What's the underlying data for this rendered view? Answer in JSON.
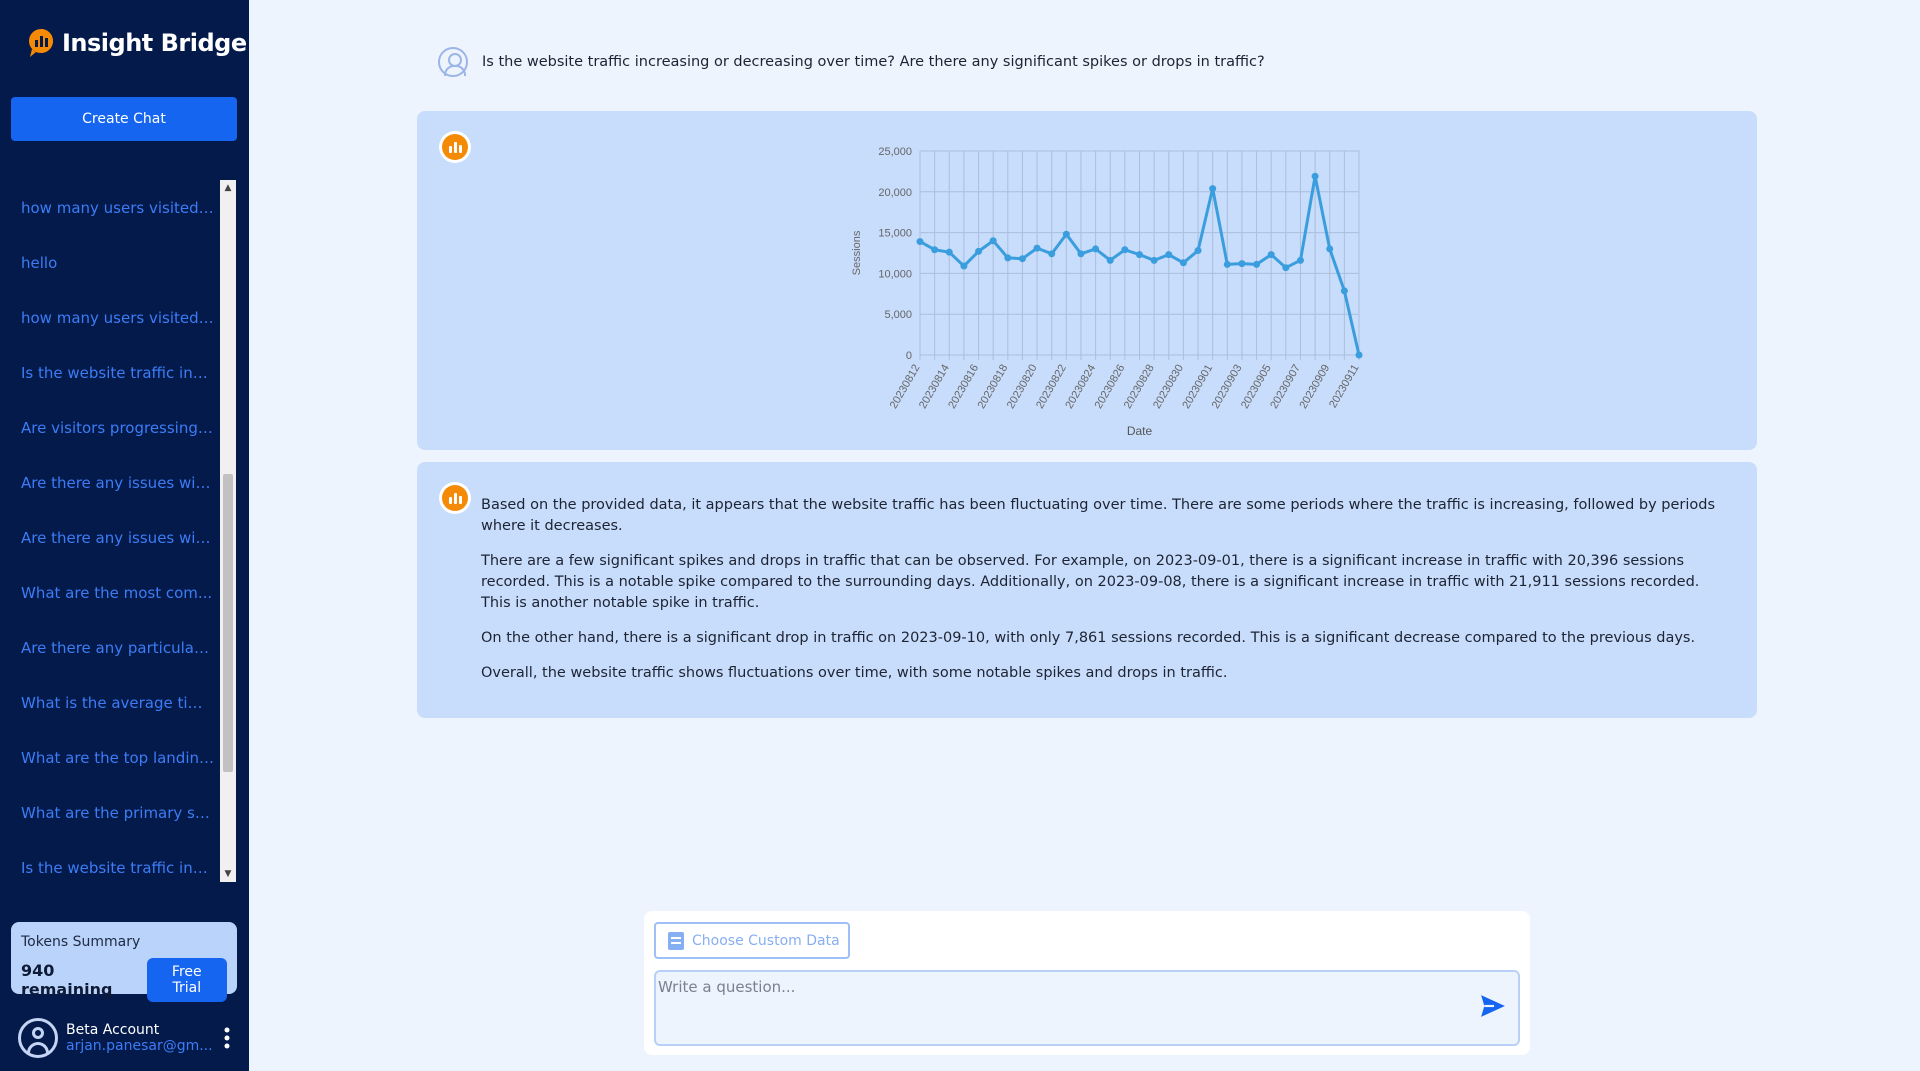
{
  "app": {
    "name": "Insight Bridge",
    "brand_color": "#1565f0",
    "accent_color": "#f58a07",
    "sidebar_color": "#031a4b"
  },
  "sidebar": {
    "create_chat_label": "Create Chat",
    "history": [
      "how many users visited t...",
      "hello",
      "how many users visited t...",
      "Is the website traffic incr...",
      "Are visitors progressing t...",
      "Are there any issues with ...",
      "Are there any issues with ...",
      "What are the most com...",
      "Are there any particular ...",
      "What is the average time...",
      "What are the top landing...",
      "What are the primary so...",
      "Is the website traffic incr..."
    ],
    "tokens": {
      "title": "Tokens Summary",
      "remaining": "940 remaining",
      "plan_label": "Free Trial"
    },
    "account": {
      "name": "Beta Account",
      "email": "arjan.panesar@gm..."
    }
  },
  "conversation": {
    "user_question": "Is the website traffic increasing or decreasing over time? Are there any significant spikes or drops in traffic?",
    "answer_paragraphs": [
      "Based on the provided data, it appears that the website traffic has been fluctuating over time. There are some periods where the traffic is increasing, followed by periods where it decreases.",
      "There are a few significant spikes and drops in traffic that can be observed. For example, on 2023-09-01, there is a significant increase in traffic with 20,396 sessions recorded. This is a notable spike compared to the surrounding days. Additionally, on 2023-09-08, there is a significant increase in traffic with 21,911 sessions recorded. This is another notable spike in traffic.",
      "On the other hand, there is a significant drop in traffic on 2023-09-10, with only 7,861 sessions recorded. This is a significant decrease compared to the previous days.",
      "Overall, the website traffic shows fluctuations over time, with some notable spikes and drops in traffic."
    ]
  },
  "composer": {
    "custom_data_label": "Choose Custom Data",
    "placeholder": "Write a question...",
    "value": ""
  },
  "chart_data": {
    "type": "line",
    "xlabel": "Date",
    "ylabel": "Sessions",
    "ylim": [
      0,
      25000
    ],
    "yticks": [
      0,
      5000,
      10000,
      15000,
      20000,
      25000
    ],
    "ytick_labels": [
      "0",
      "5,000",
      "10,000",
      "15,000",
      "20,000",
      "25,000"
    ],
    "xtick_labels": [
      "20230812",
      "20230814",
      "20230816",
      "20230818",
      "20230820",
      "20230822",
      "20230824",
      "20230826",
      "20230828",
      "20230830",
      "20230901",
      "20230903",
      "20230905",
      "20230907",
      "20230909",
      "20230911"
    ],
    "grid": true,
    "line_color": "#3a9ede",
    "x": [
      "20230812",
      "20230813",
      "20230814",
      "20230815",
      "20230816",
      "20230817",
      "20230818",
      "20230819",
      "20230820",
      "20230821",
      "20230822",
      "20230823",
      "20230824",
      "20230825",
      "20230826",
      "20230827",
      "20230828",
      "20230829",
      "20230830",
      "20230831",
      "20230901",
      "20230902",
      "20230903",
      "20230904",
      "20230905",
      "20230906",
      "20230907",
      "20230908",
      "20230909",
      "20230910",
      "20230911"
    ],
    "values": [
      13900,
      12900,
      12600,
      10900,
      12700,
      14000,
      11900,
      11800,
      13100,
      12400,
      14800,
      12400,
      13000,
      11600,
      12900,
      12300,
      11600,
      12300,
      11300,
      12800,
      20396,
      11100,
      11200,
      11100,
      12300,
      10700,
      11600,
      21911,
      13000,
      7861,
      0
    ]
  }
}
